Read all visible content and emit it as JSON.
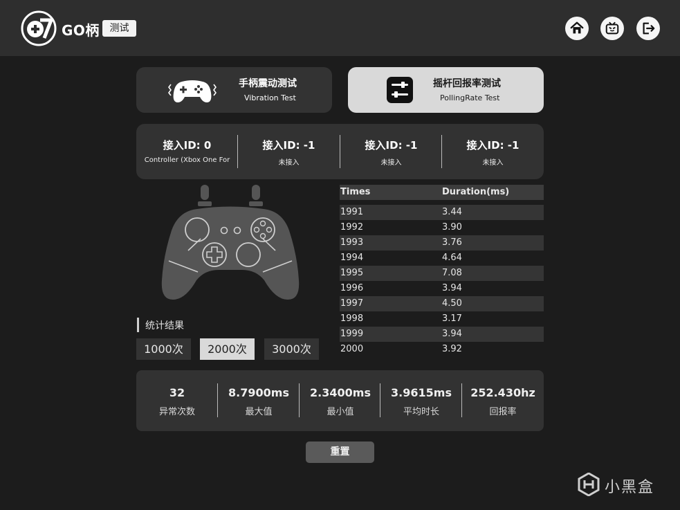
{
  "header": {
    "brand": "GO柄",
    "badge": "测试",
    "icons": [
      "home-icon",
      "bilibili-tv-icon",
      "logout-icon"
    ]
  },
  "modes": [
    {
      "title": "手柄震动测试",
      "subtitle": "Vibration Test",
      "icon": "gamepad-vibration-icon",
      "active": false
    },
    {
      "title": "摇杆回报率测试",
      "subtitle": "PollingRate Test",
      "icon": "sliders-icon",
      "active": true
    }
  ],
  "slots": [
    {
      "title": "接入ID: 0",
      "subtitle": "Controller (Xbox One For"
    },
    {
      "title": "接入ID: -1",
      "subtitle": "未接入"
    },
    {
      "title": "接入ID: -1",
      "subtitle": "未接入"
    },
    {
      "title": "接入ID: -1",
      "subtitle": "未接入"
    }
  ],
  "table": {
    "headers": [
      "Times",
      "Duration(ms)"
    ],
    "rows": [
      [
        "1991",
        "3.44"
      ],
      [
        "1992",
        "3.90"
      ],
      [
        "1993",
        "3.76"
      ],
      [
        "1994",
        "4.64"
      ],
      [
        "1995",
        "7.08"
      ],
      [
        "1996",
        "3.94"
      ],
      [
        "1997",
        "4.50"
      ],
      [
        "1998",
        "3.17"
      ],
      [
        "1999",
        "3.94"
      ],
      [
        "2000",
        "3.92"
      ]
    ]
  },
  "stats": {
    "label": "统计结果",
    "counts": [
      {
        "label": "1000次",
        "selected": false
      },
      {
        "label": "2000次",
        "selected": true
      },
      {
        "label": "3000次",
        "selected": false
      }
    ]
  },
  "summary": [
    {
      "value": "32",
      "label": "异常次数"
    },
    {
      "value": "8.7900ms",
      "label": "最大值"
    },
    {
      "value": "2.3400ms",
      "label": "最小值"
    },
    {
      "value": "3.9615ms",
      "label": "平均时长"
    },
    {
      "value": "252.430hz",
      "label": "回报率"
    }
  ],
  "reset_label": "重置",
  "watermark": "小黑盒",
  "colors": {
    "background": "#1c1c1c",
    "header": "#2e2e2e",
    "panel": "#323232",
    "active_tab": "#d9d9d9"
  }
}
